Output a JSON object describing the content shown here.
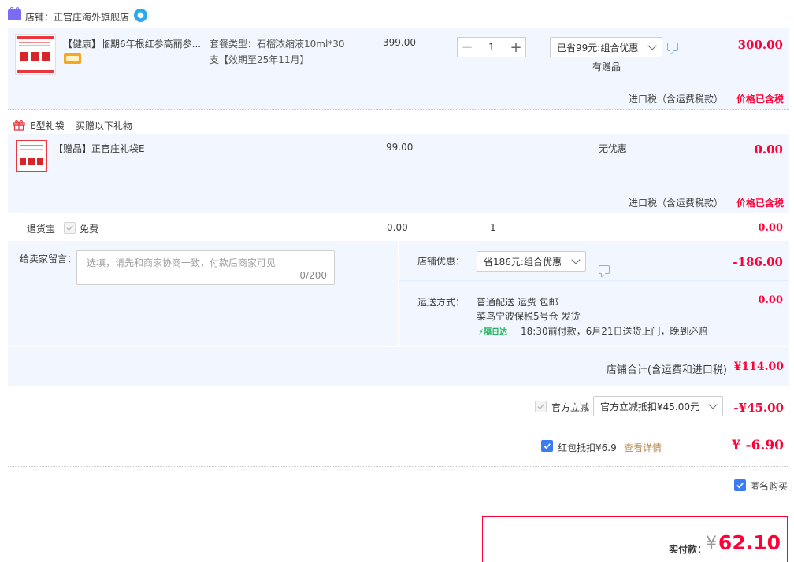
{
  "shop": {
    "label": "店铺：正官庄海外旗舰店"
  },
  "item1": {
    "title": "【健康】临期6年根红参高丽参...",
    "spec_line1": "套餐类型：石榴浓缩液10ml*30",
    "spec_line2": "支【效期至25年11月】",
    "unit_price": "399.00",
    "qty": "1",
    "promo_select": "已省99元:组合优惠",
    "gift_note": "有赠品",
    "subtotal": "300.00",
    "tax_label": "进口税（含运费税款）",
    "tax_value": "价格已含税"
  },
  "gift": {
    "header_type": "E型礼袋",
    "header_desc": "买赠以下礼物",
    "title": "【赠品】正官庄礼袋E",
    "unit_price": "99.00",
    "promo": "无优惠",
    "subtotal": "0.00",
    "tax_label": "进口税（含运费税款）",
    "tax_value": "价格已含税"
  },
  "return_insurance": {
    "label": "退货宝",
    "option": "免费",
    "price": "0.00",
    "qty": "1",
    "subtotal": "0.00"
  },
  "message": {
    "label": "给卖家留言：",
    "placeholder": "选填，请先和商家协商一致，付款后商家可见",
    "counter": "0/200"
  },
  "shop_discount": {
    "label": "店铺优惠：",
    "select": "省186元:组合优惠",
    "amount": "-186.00"
  },
  "shipping": {
    "label": "运送方式：",
    "line1": "普通配送 运费 包邮",
    "line2": "菜鸟宁波保税5号仓   发货",
    "badge": "隔日达",
    "line3": "18:30前付款，6月21日送货上门，晚到必赔",
    "amount": "0.00"
  },
  "shop_total": {
    "label": "店铺合计(含运费和进口税)",
    "amount": "¥114.00"
  },
  "official": {
    "label": "官方立减",
    "select": "官方立减抵扣¥45.00元",
    "amount": "-¥45.00"
  },
  "redpacket": {
    "label": "红包抵扣¥6.9",
    "link": "查看详情",
    "amount": "¥ -6.90"
  },
  "anonymous": {
    "label": "匿名购买"
  },
  "pay": {
    "label": "实付款：",
    "currency": "¥",
    "amount": "62.10"
  },
  "colors": {
    "accent_red": "#ff0036",
    "blue_bg": "#f2f7ff",
    "check_blue": "#3b7cf5"
  }
}
